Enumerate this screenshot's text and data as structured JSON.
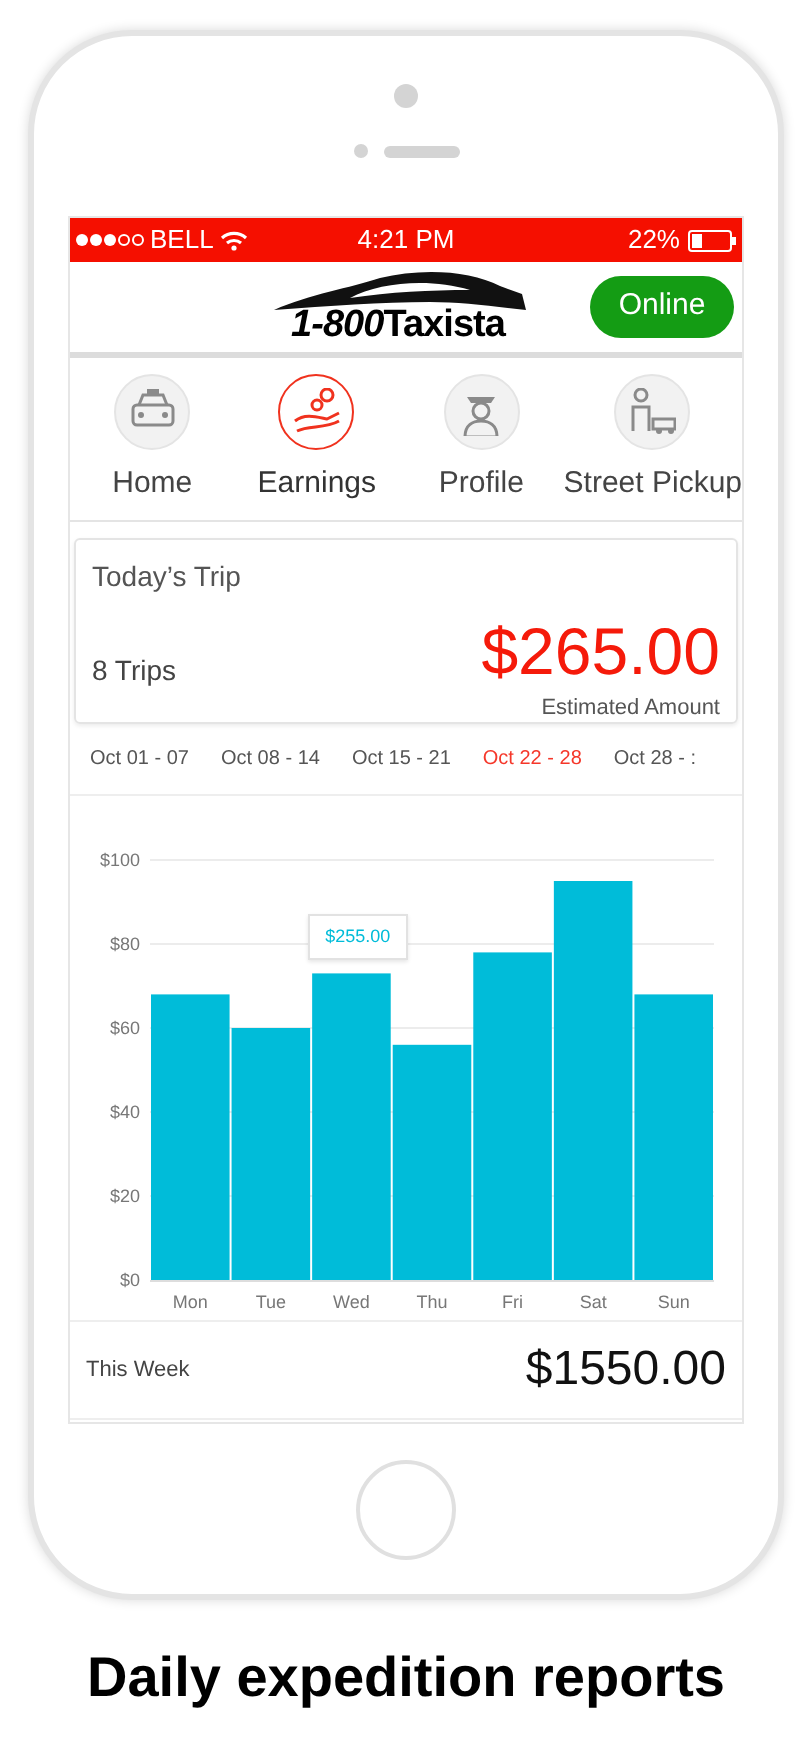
{
  "status_bar": {
    "carrier": "BELL",
    "time": "4:21 PM",
    "battery": "22%"
  },
  "header": {
    "logo_number": "1-800",
    "logo_name": "Taxista",
    "status_button": "Online"
  },
  "nav": [
    {
      "label": "Home",
      "selected": false
    },
    {
      "label": "Earnings",
      "selected": true
    },
    {
      "label": "Profile",
      "selected": false
    },
    {
      "label": "Street Pickup",
      "selected": false
    }
  ],
  "today": {
    "title": "Today’s Trip",
    "trips": "8 Trips",
    "amount": "$265.00",
    "amount_label": "Estimated Amount"
  },
  "weeks": [
    {
      "label": "Oct 01 - 07",
      "selected": false
    },
    {
      "label": "Oct 08 - 14",
      "selected": false
    },
    {
      "label": "Oct 15 - 21",
      "selected": false
    },
    {
      "label": "Oct 22 - 28",
      "selected": true
    },
    {
      "label": "Oct 28 - :",
      "selected": false
    }
  ],
  "chart": {
    "tooltip": "$255.00",
    "chart_data": {
      "type": "bar",
      "categories": [
        "Mon",
        "Tue",
        "Wed",
        "Thu",
        "Fri",
        "Sat",
        "Sun"
      ],
      "series": [
        {
          "color": "#00bcd9",
          "values": [
            68,
            60,
            73,
            56,
            78,
            95,
            68
          ]
        }
      ],
      "grid": true,
      "ylim": [
        0,
        100
      ],
      "yticks": [
        {
          "value": 0,
          "label": "$0"
        },
        {
          "value": 20,
          "label": "$20"
        },
        {
          "value": 40,
          "label": "$40"
        },
        {
          "value": 60,
          "label": "$60"
        },
        {
          "value": 80,
          "label": "$80"
        },
        {
          "value": 100,
          "label": "$100"
        }
      ]
    }
  },
  "week_total": {
    "label": "This Week",
    "amount": "$1550.00"
  },
  "caption": "Daily expedition reports"
}
